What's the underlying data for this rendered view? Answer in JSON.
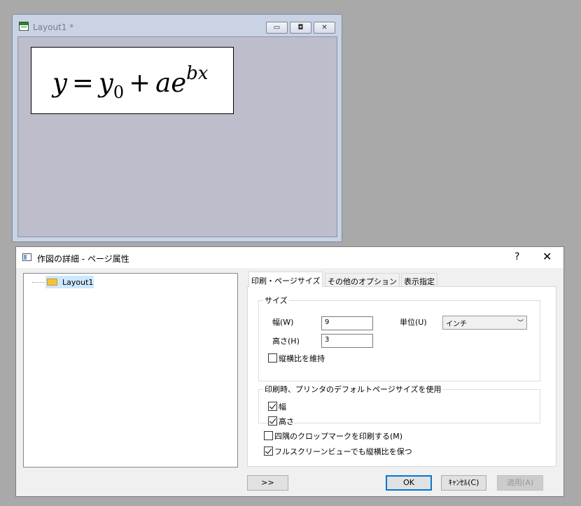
{
  "layout_window": {
    "title": "Layout1 *",
    "formula": {
      "lhs": "y",
      "equals": "=",
      "y0_base": "y",
      "y0_sub": "0",
      "plus": "+",
      "a": "a",
      "e": "e",
      "exponent": "bx"
    },
    "buttons": {
      "minimize": "▭",
      "restore": "◘",
      "close": "✕"
    }
  },
  "dialog": {
    "title": "作図の詳細 - ページ属性",
    "help": "?",
    "close": "✕",
    "tree": {
      "items": [
        {
          "label": "Layout1"
        }
      ]
    },
    "tabs": [
      {
        "label": "印刷・ページサイズ",
        "active": true
      },
      {
        "label": "その他のオプション",
        "active": false
      },
      {
        "label": "表示指定",
        "active": false
      }
    ],
    "size_group": {
      "legend": "サイズ",
      "width_label": "幅(W)",
      "width_value": "9",
      "height_label": "高さ(H)",
      "height_value": "3",
      "unit_label": "単位(U)",
      "unit_value": "インチ",
      "keep_ratio_label": "縦横比を維持",
      "keep_ratio_checked": false
    },
    "default_group": {
      "legend": "印刷時、プリンタのデフォルトページサイズを使用",
      "width_label": "幅",
      "width_checked": true,
      "height_label": "高さ",
      "height_checked": true
    },
    "crop_marks_label": "四隅のクロップマークを印刷する(M)",
    "crop_marks_checked": false,
    "fullscreen_ratio_label": "フルスクリーンビューでも縦横比を保つ",
    "fullscreen_ratio_checked": true,
    "buttons": {
      "expand": ">>",
      "ok": "OK",
      "cancel": "ｷｬﾝｾﾙ(C)",
      "apply": "適用(A)"
    }
  }
}
